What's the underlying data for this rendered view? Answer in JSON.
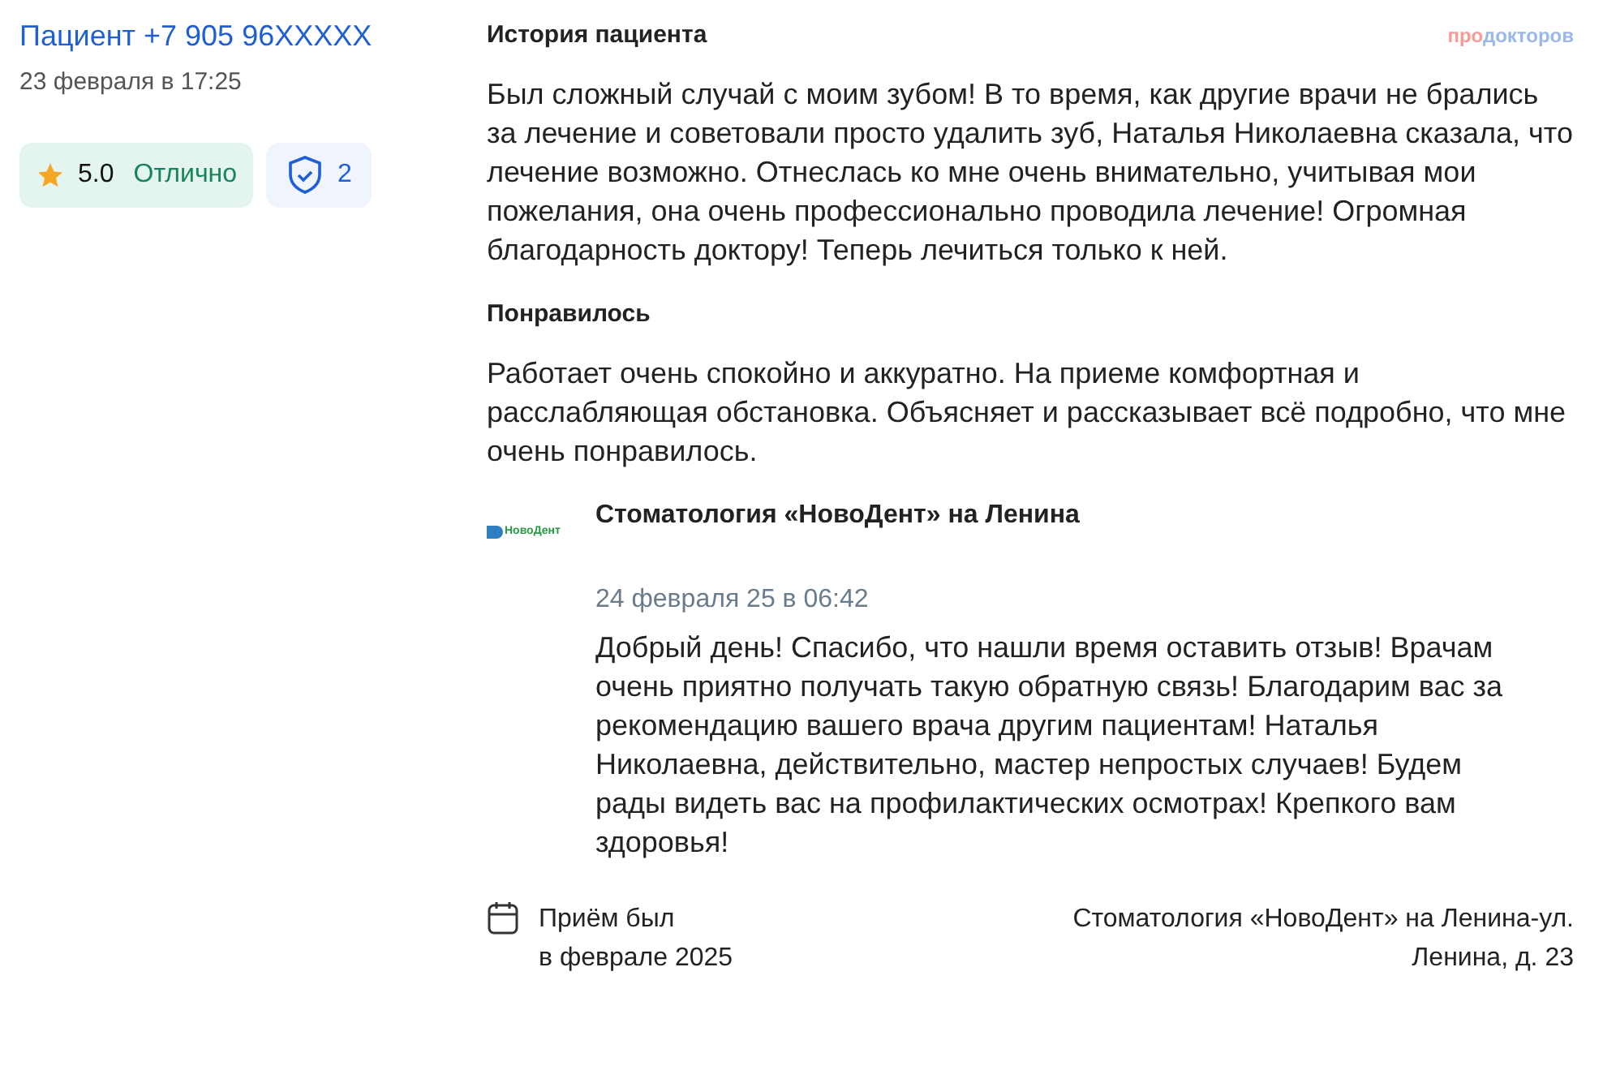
{
  "author": {
    "name": "Пациент +7 905 96XXXXX",
    "date": "23 февраля в 17:25"
  },
  "rating": {
    "score": "5.0",
    "label": "Отлично"
  },
  "verified": {
    "count": "2"
  },
  "brand": {
    "part_1": "про",
    "part_2": "докторов"
  },
  "sections": [
    {
      "title": "История пациента",
      "text": "Был сложный случай с моим зубом! В то время, как другие врачи не брались за лечение и советовали просто удалить зуб, Наталья Николаевна сказала, что лечение возможно. Отнеслась ко мне очень внимательно, учитывая мои пожелания, она очень профессионально проводила лечение! Огромная благодарность доктору! Теперь лечиться только к ней."
    },
    {
      "title": "Понравилось",
      "text": "Работает очень спокойно и аккуратно. На приеме комфортная и расслабляющая обстановка. Объясняет и рассказывает всё подробно, что мне очень понравилось."
    }
  ],
  "reply": {
    "logo_text": "НовоДент",
    "clinic": "Стоматология «НовоДент» на Ленина",
    "date": "24 февраля 25 в 06:42",
    "text": "Добрый день! Спасибо, что нашли время оставить отзыв! Врачам очень приятно получать такую обратную связь! Благодарим вас за рекомендацию вашего врача другим пациентам! Наталья Николаевна, действительно, мастер непростых случаев! Будем рады видеть вас на профилактических осмотрах! Крепкого вам здоровья!"
  },
  "visit": {
    "line_1": "Приём был",
    "line_2": "в феврале 2025"
  },
  "address": {
    "line_1": "Стоматология «НовоДент» на Ленина-ул.",
    "line_2": "Ленина, д. 23"
  }
}
